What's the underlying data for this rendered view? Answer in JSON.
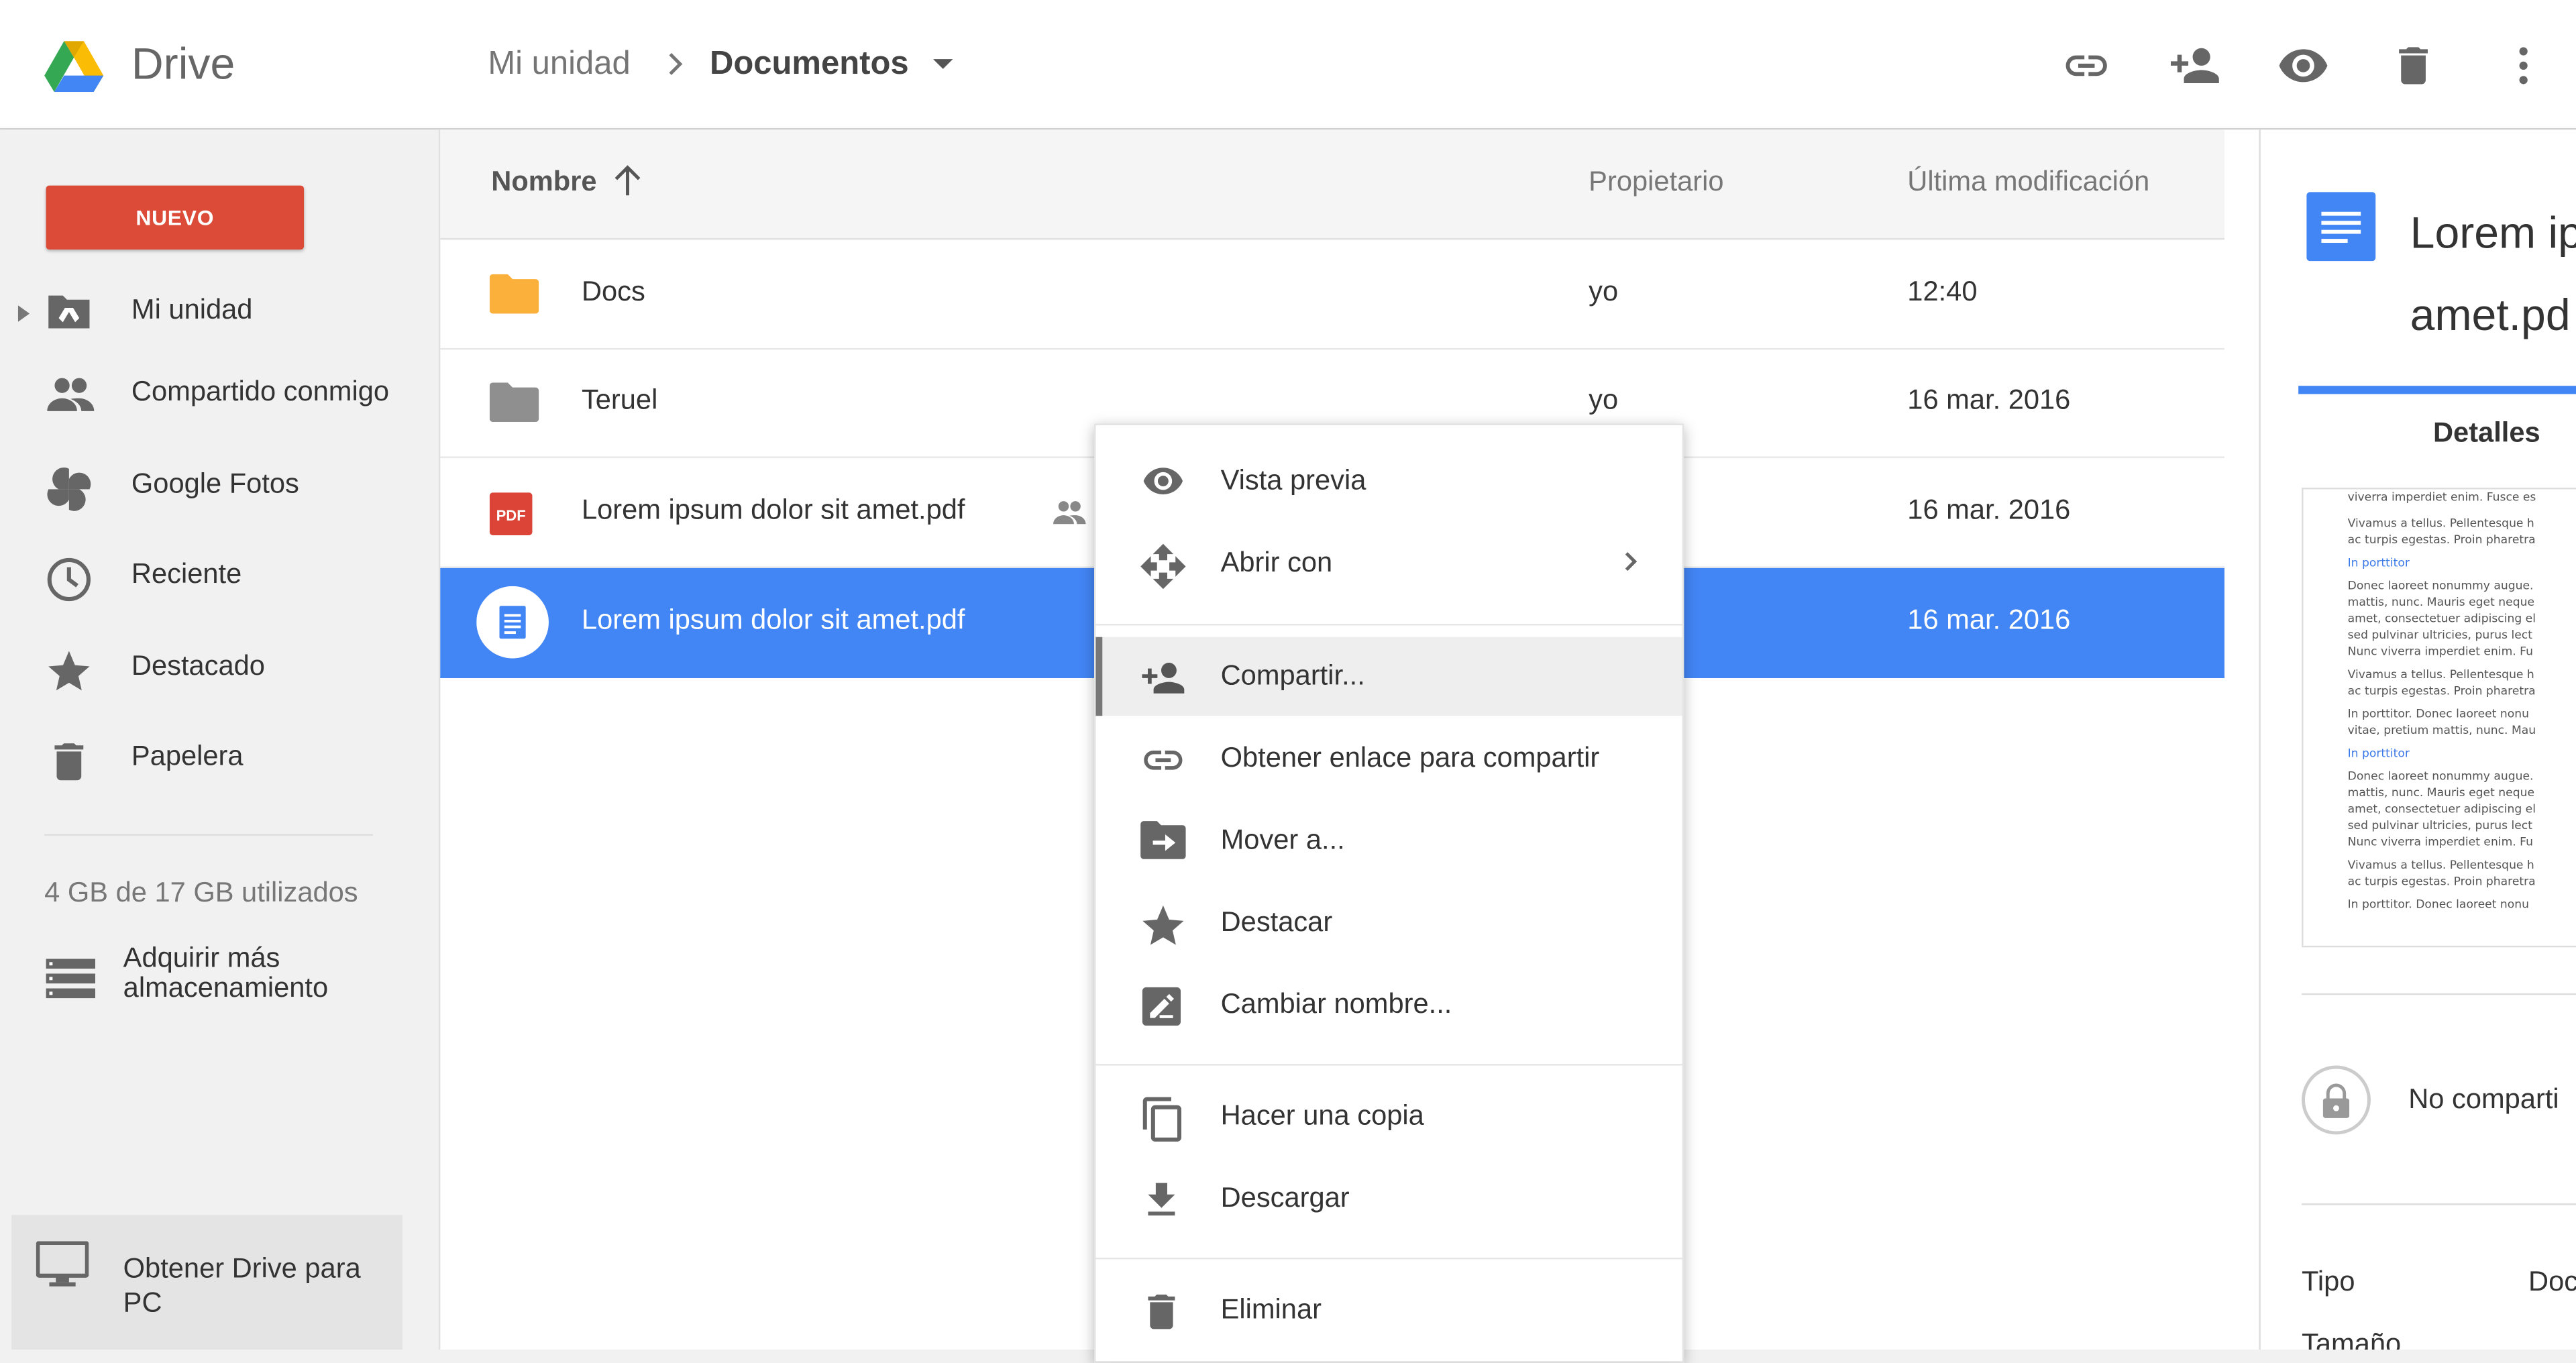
{
  "header": {
    "brand": "Drive",
    "breadcrumb": {
      "root": "Mi unidad",
      "current": "Documentos"
    },
    "actions": [
      "link-icon",
      "person-add-icon",
      "eye-icon",
      "trash-icon",
      "more-vert-icon"
    ]
  },
  "sidebar": {
    "new_button": "NUEVO",
    "items": [
      {
        "label": "Mi unidad",
        "icon": "drive-folder-icon"
      },
      {
        "label": "Compartido conmigo",
        "icon": "people-icon"
      },
      {
        "label": "Google Fotos",
        "icon": "pinwheel-icon"
      },
      {
        "label": "Reciente",
        "icon": "clock-icon"
      },
      {
        "label": "Destacado",
        "icon": "star-icon"
      },
      {
        "label": "Papelera",
        "icon": "trash-icon"
      }
    ],
    "storage_text": "4 GB de 17 GB utilizados",
    "buy_storage": [
      "Adquirir más",
      "almacenamiento"
    ],
    "get_drive": [
      "Obtener Drive para",
      "PC"
    ]
  },
  "file_list": {
    "columns": {
      "name": "Nombre",
      "owner": "Propietario",
      "modified": "Última modificación"
    },
    "rows": [
      {
        "name": "Docs",
        "owner": "yo",
        "modified": "12:40",
        "type": "folder-orange"
      },
      {
        "name": "Teruel",
        "owner": "yo",
        "modified": "16 mar. 2016",
        "type": "folder-grey"
      },
      {
        "name": "Lorem ipsum dolor sit amet.pdf",
        "owner": "",
        "modified": "16 mar. 2016",
        "type": "pdf",
        "shared": true
      },
      {
        "name": "Lorem ipsum dolor sit amet.pdf",
        "owner": "",
        "modified": "16 mar. 2016",
        "type": "doc",
        "selected": true
      }
    ]
  },
  "context_menu": {
    "items": [
      {
        "label": "Vista previa",
        "icon": "eye-icon"
      },
      {
        "label": "Abrir con",
        "icon": "move-arrows-icon",
        "submenu": true
      },
      {
        "label": "Compartir...",
        "icon": "person-add-icon",
        "highlighted": true
      },
      {
        "label": "Obtener enlace para compartir",
        "icon": "link-icon"
      },
      {
        "label": "Mover a...",
        "icon": "folder-move-icon"
      },
      {
        "label": "Destacar",
        "icon": "star-icon"
      },
      {
        "label": "Cambiar nombre...",
        "icon": "rename-icon"
      },
      {
        "label": "Hacer una copia",
        "icon": "copy-icon"
      },
      {
        "label": "Descargar",
        "icon": "download-icon"
      },
      {
        "label": "Eliminar",
        "icon": "trash-icon"
      }
    ]
  },
  "details_panel": {
    "title_line1": "Lorem ip",
    "title_line2": "amet.pd",
    "tab": "Detalles",
    "preview_lines": [
      "viverra imperdiet enim. Fusce es",
      "Vivamus a tellus. Pellentesque h",
      "ac turpis egestas. Proin pharetra",
      "In porttitor",
      "Donec laoreet nonummy augue.",
      "mattis, nunc. Mauris eget neque",
      "amet, consectetuer adipiscing el",
      "sed pulvinar ultricies, purus lect",
      "Nunc viverra imperdiet enim. Fu",
      "Vivamus a tellus. Pellentesque h",
      "ac turpis egestas. Proin pharetra",
      "In porttitor. Donec laoreet nonu",
      "vitae, pretium mattis, nunc. Mau",
      "In porttitor",
      "Donec laoreet nonummy augue.",
      "mattis, nunc. Mauris eget neque",
      "amet, consectetuer adipiscing el",
      "sed pulvinar ultricies, purus lect",
      "Nunc viverra imperdiet enim. Fu",
      "Vivamus a tellus. Pellentesque h",
      "ac turpis egestas. Proin pharetra",
      "In porttitor. Donec laoreet nonu"
    ],
    "share_state": "No comparti",
    "type_label": "Tipo",
    "type_value": "Doc",
    "size_label": "Tamaño"
  },
  "colors": {
    "accent": "#4285f4",
    "new_button": "#dc4a38",
    "folder": "#fbb03b",
    "pdf": "#db4437"
  }
}
